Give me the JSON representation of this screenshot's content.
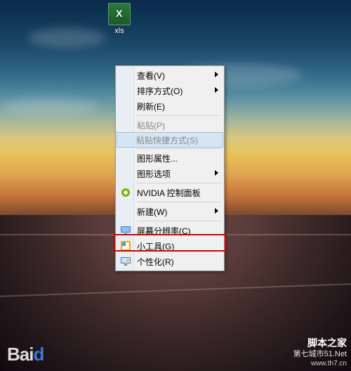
{
  "desktop_icon": {
    "label": "xls"
  },
  "context_menu": {
    "view": {
      "label": "查看(V)",
      "submenu": true
    },
    "sort": {
      "label": "排序方式(O)",
      "submenu": true
    },
    "refresh": {
      "label": "刷新(E)"
    },
    "paste": {
      "label": "粘贴(P)",
      "disabled": true
    },
    "paste_shortcut": {
      "label": "粘贴快捷方式(S)",
      "disabled": true
    },
    "gfx_props": {
      "label": "图形属性..."
    },
    "gfx_options": {
      "label": "图形选项",
      "submenu": true
    },
    "nvidia": {
      "label": "NVIDIA 控制面板"
    },
    "new": {
      "label": "新建(W)",
      "submenu": true
    },
    "resolution": {
      "label": "屏幕分辨率(C)"
    },
    "gadgets": {
      "label": "小工具(G)"
    },
    "personalize": {
      "label": "个性化(R)"
    }
  },
  "colors": {
    "highlight_border": "#d40000"
  },
  "watermarks": {
    "left": {
      "brand_prefix": "Bai",
      "brand_accent": "d"
    },
    "right": {
      "line1": "脚本之家",
      "line2": "第七城市51.Net",
      "line3": "www.th7.cn"
    }
  }
}
